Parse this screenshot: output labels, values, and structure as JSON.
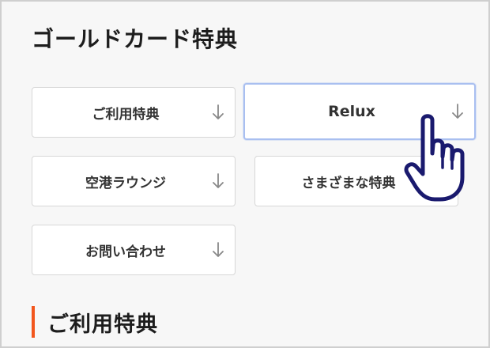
{
  "page": {
    "title": "ゴールドカード特典"
  },
  "nav_buttons": [
    {
      "label": "ご利用特典",
      "icon": "arrow-down-icon"
    },
    {
      "label": "Relux",
      "icon": "arrow-down-icon",
      "state": "hovered"
    },
    {
      "label": "空港ラウンジ",
      "icon": "arrow-down-icon"
    },
    {
      "label": "さまざまな特典",
      "icon": "arrow-down-icon"
    },
    {
      "label": "お問い合わせ",
      "icon": "arrow-down-icon"
    }
  ],
  "section": {
    "heading": "ご利用特典"
  },
  "colors": {
    "accent": "#f2561d",
    "cursor_outline": "#1a1a6e",
    "active_border": "#a9bff0"
  },
  "cursor": {
    "icon": "pointing-hand-cursor-icon"
  }
}
